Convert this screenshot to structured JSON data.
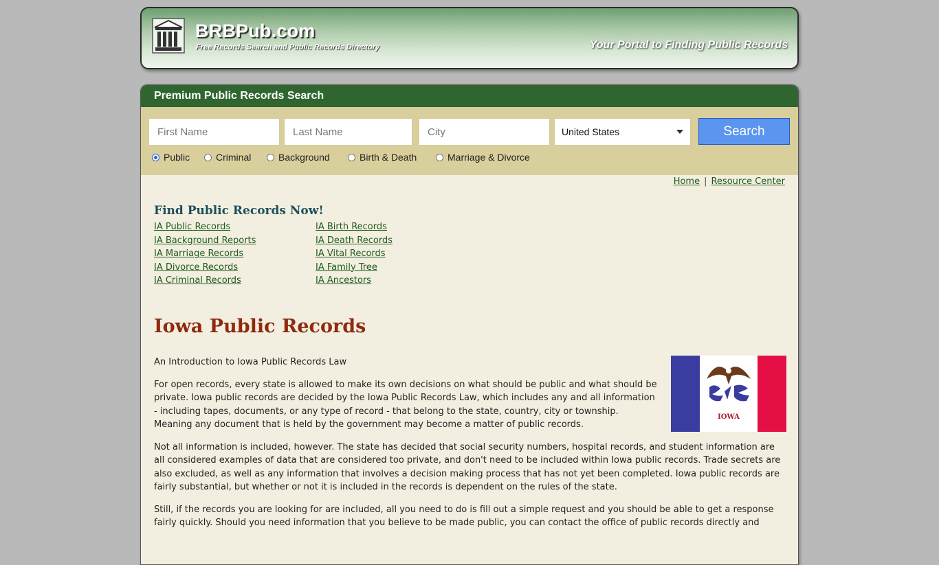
{
  "header": {
    "site_name": "BRBPub.com",
    "subtitle": "Free Records Search and Public Records Directory",
    "tagline": "Your Portal to Finding Public Records"
  },
  "search": {
    "title": "Premium Public Records Search",
    "first_name_placeholder": "First Name",
    "last_name_placeholder": "Last Name",
    "city_placeholder": "City",
    "country_selected": "United States",
    "button_label": "Search",
    "record_types": [
      {
        "label": "Public",
        "checked": true
      },
      {
        "label": "Criminal",
        "checked": false
      },
      {
        "label": "Background",
        "checked": false
      },
      {
        "label": "Birth & Death",
        "checked": false
      },
      {
        "label": "Marriage & Divorce",
        "checked": false
      }
    ]
  },
  "nav": {
    "home": "Home",
    "separator": "|",
    "resource_center": "Resource Center"
  },
  "find": {
    "heading": "Find Public Records Now!",
    "left_links": [
      "IA Public Records",
      "IA Background Reports",
      "IA Marriage Records",
      "IA Divorce Records",
      "IA Criminal Records"
    ],
    "right_links": [
      "IA Birth Records",
      "IA Death Records",
      "IA Vital Records",
      "IA Family Tree",
      "IA Ancestors"
    ]
  },
  "article": {
    "title": "Iowa Public Records",
    "intro": "An Introduction to Iowa Public Records Law",
    "p1": "For open records, every state is allowed to make its own decisions on what should be public and what should be private. Iowa public records are decided by the Iowa Public Records Law, which includes any and all information - including tapes, documents, or any type of record - that belong to the state, country, city or township. Meaning any document that is held by the government may become a matter of public records.",
    "p2": "Not all information is included, however. The state has decided that social security numbers, hospital records, and student information are all considered examples of data that are considered too private, and don't need to be included within Iowa public records. Trade secrets are also excluded, as well as any information that involves a decision making process that has not yet been completed. Iowa public records are fairly substantial, but whether or not it is included in the records is dependent on the rules of the state.",
    "p3": "Still, if the records you are looking for are included, all you need to do is fill out a simple request and you should be able to get a response fairly quickly. Should you need information that you believe to be made public, you can contact the office of public records directly and",
    "flag_text": "IOWA"
  },
  "colors": {
    "header_green": "#2f6630",
    "search_panel": "#d9cf9c",
    "content_bg": "#f3efe0",
    "title_red": "#8e2a10",
    "link_green": "#1e5b1e",
    "button_blue": "#5b95f0"
  }
}
